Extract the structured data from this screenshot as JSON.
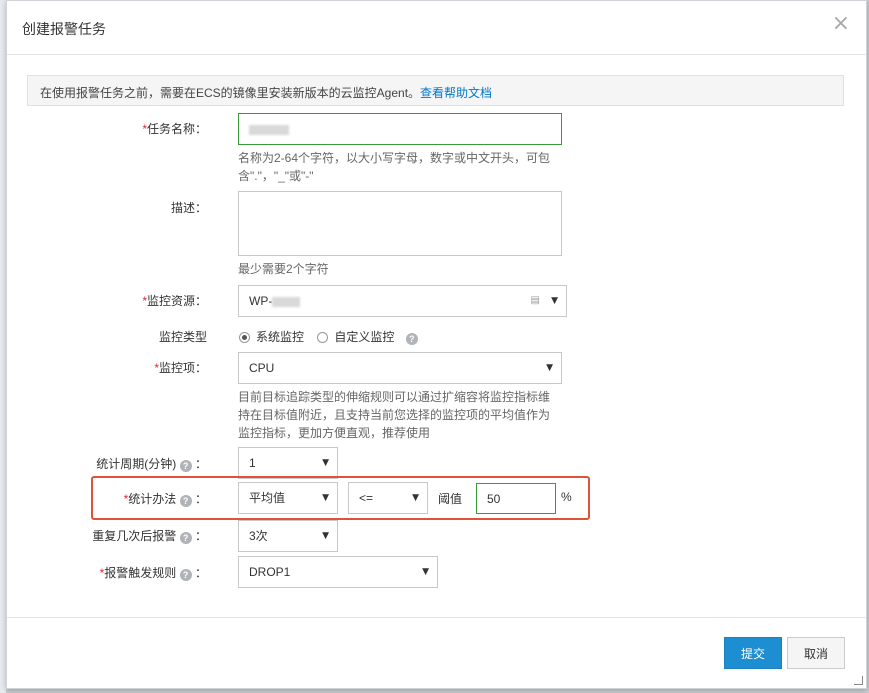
{
  "dialog": {
    "title": "创建报警任务",
    "close_icon": "×"
  },
  "notice": {
    "text": "在使用报警任务之前，需要在ECS的镜像里安装新版本的云监控Agent。",
    "link": "查看帮助文档"
  },
  "form": {
    "task_name": {
      "required": "*",
      "label": "任务名称：",
      "hint": "名称为2-64个字符，以大小写字母，数字或中文开头，可包含\".\"，\"_\"或\"-\""
    },
    "description": {
      "label": "描述：",
      "hint": "最少需要2个字符"
    },
    "monitor_resource": {
      "required": "*",
      "label": "监控资源：",
      "value_prefix": "WP-"
    },
    "monitor_type": {
      "label": "监控类型",
      "option_system": "系统监控",
      "option_custom": "自定义监控",
      "selected": "系统监控"
    },
    "monitor_item": {
      "required": "*",
      "label": "监控项：",
      "value": "CPU",
      "hint_line1": "目前目标追踪类型的伸缩规则可以通过扩缩容将监控指标维",
      "hint_line2": "持在目标值附近，且支持当前您选择的监控项的平均值作为",
      "hint_line3": "监控指标，更加方便直观，推荐使用"
    },
    "period": {
      "label": "统计周期(分钟)",
      "colon": "：",
      "value": "1"
    },
    "method": {
      "required": "*",
      "label": "统计办法",
      "colon": "：",
      "value": "平均值",
      "operator": "<=",
      "threshold_label": "阈值",
      "threshold_value": "50",
      "unit": "%"
    },
    "repeat": {
      "label": "重复几次后报警",
      "colon": "：",
      "value": "3次"
    },
    "trigger_rule": {
      "required": "*",
      "label": "报警触发规则",
      "colon": "：",
      "value": "DROP1"
    }
  },
  "footer": {
    "submit": "提交",
    "cancel": "取消"
  },
  "colors": {
    "primary": "#1d8ed1",
    "required": "#e0262e",
    "highlight": "#e0533a",
    "valid_border": "#3a9a3a"
  }
}
